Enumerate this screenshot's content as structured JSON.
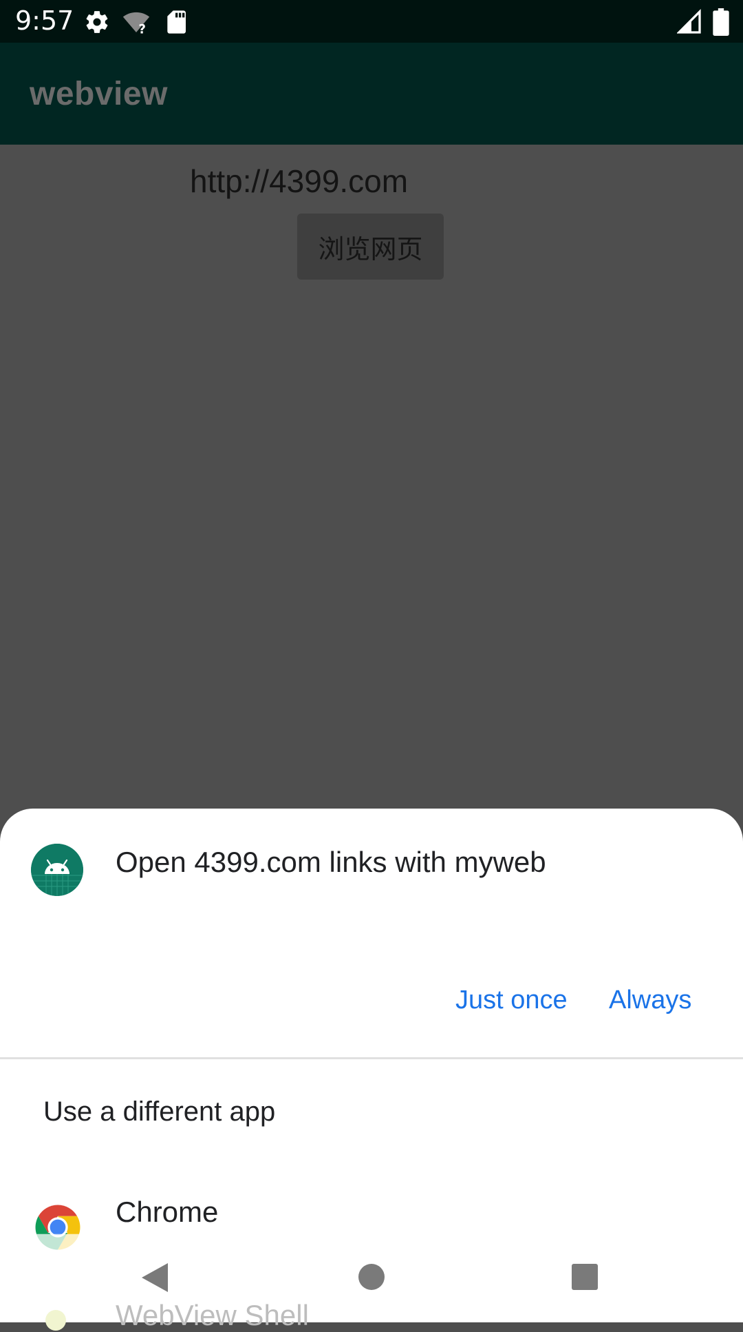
{
  "status_bar": {
    "time": "9:57",
    "icons": [
      "settings-gear-icon",
      "wifi-unknown-icon",
      "sd-card-icon",
      "cell-signal-icon",
      "battery-icon"
    ]
  },
  "app_bar": {
    "title": "webview"
  },
  "content": {
    "url_text": "http://4399.com",
    "browse_button_label": "浏览网页"
  },
  "sheet": {
    "title": "Open 4399.com links with myweb",
    "just_once_label": "Just once",
    "always_label": "Always",
    "different_app_label": "Use a different app",
    "apps": [
      {
        "label": "Chrome",
        "icon": "chrome-icon"
      },
      {
        "label": "WebView Shell",
        "icon": "webview-shell-icon"
      }
    ]
  },
  "nav_bar": {
    "icons": [
      "back-icon",
      "home-icon",
      "recents-icon"
    ]
  },
  "colors": {
    "accent": "#1a73e8",
    "app_bar": "#012622",
    "status_bar": "#00130f",
    "scrim_background": "#4e4e4e"
  }
}
